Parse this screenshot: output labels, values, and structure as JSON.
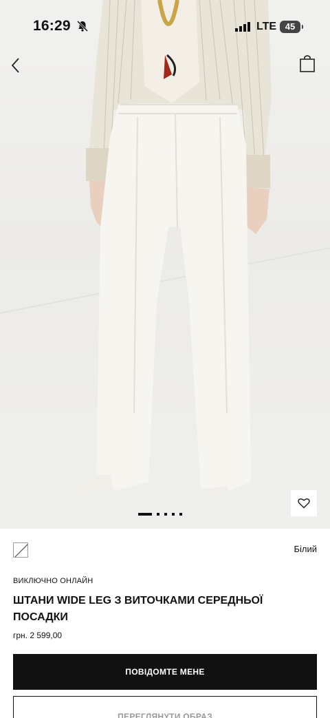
{
  "status_bar": {
    "time": "16:29",
    "network": "LTE",
    "battery": "45",
    "icons": [
      "bell-off-icon",
      "signal-icon"
    ]
  },
  "navigation": {
    "back_icon": "chevron-left-icon",
    "bag_icon": "shopping-bag-icon"
  },
  "gallery": {
    "image_count": 5,
    "current_index": 1,
    "wishlist_icon": "heart-icon"
  },
  "product": {
    "color_name": "Білий",
    "badge": "ВИКЛЮЧНО ОНЛАЙН",
    "title": "ШТАНИ WIDE LEG З ВИТОЧКАМИ СЕРЕДНЬОЇ ПОСАДКИ",
    "price": "грн. 2 599,00"
  },
  "actions": {
    "notify_label": "ПОВІДОМТЕ МЕНЕ",
    "look_label": "ПЕРЕГЛЯНУТИ ОБРАЗ"
  },
  "colors": {
    "button_bg": "#111111",
    "pants": "#f6f5f0",
    "shirt": "#e6e1d3"
  }
}
